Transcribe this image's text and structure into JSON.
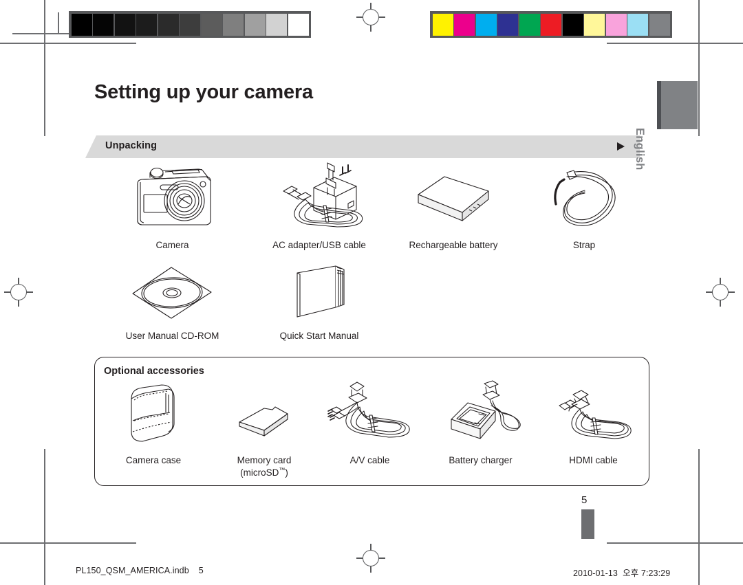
{
  "page": {
    "title": "Setting up your camera",
    "language_tab": "English",
    "page_number": "5"
  },
  "section": {
    "heading": "Unpacking",
    "banner_color": "#d9d9d9",
    "arrow_icon": "triangle-right-icon"
  },
  "unpacking": {
    "row1": [
      {
        "caption": "Camera",
        "icon": "camera-icon"
      },
      {
        "caption": "AC adapter/USB cable",
        "icon": "ac-adapter-usb-cable-icon"
      },
      {
        "caption": "Rechargeable battery",
        "icon": "battery-icon"
      },
      {
        "caption": "Strap",
        "icon": "strap-icon"
      }
    ],
    "row2": [
      {
        "caption": "User Manual CD-ROM",
        "icon": "cd-rom-icon"
      },
      {
        "caption": "Quick Start Manual",
        "icon": "manual-book-icon"
      }
    ]
  },
  "optional": {
    "heading": "Optional accessories",
    "items": [
      {
        "caption": "Camera case",
        "caption2": "",
        "icon": "camera-case-icon"
      },
      {
        "caption": "Memory card",
        "caption2": "(microSD™)",
        "icon": "memory-card-icon"
      },
      {
        "caption": "A/V cable",
        "caption2": "",
        "icon": "av-cable-icon"
      },
      {
        "caption": "Battery charger",
        "caption2": "",
        "icon": "battery-charger-icon"
      },
      {
        "caption": "HDMI cable",
        "caption2": "",
        "icon": "hdmi-cable-icon"
      }
    ]
  },
  "footer": {
    "filename": "PL150_QSM_AMERICA.indb",
    "page": "5",
    "date": "2010-01-13",
    "time": "오후 7:23:29"
  },
  "print_marks": {
    "grayscale_swatches": [
      "#000000",
      "#050505",
      "#121212",
      "#1c1c1c",
      "#2b2b2b",
      "#3d3d3d",
      "#5c5c5c",
      "#7f7f7f",
      "#a0a0a0",
      "#d2d2d2",
      "#ffffff"
    ],
    "color_swatches": [
      "#fff200",
      "#ec008c",
      "#00aeef",
      "#2e3192",
      "#00a651",
      "#ed1c24",
      "#000000",
      "#fff79a",
      "#f9a3dc",
      "#9bdff4",
      "#808285"
    ]
  }
}
